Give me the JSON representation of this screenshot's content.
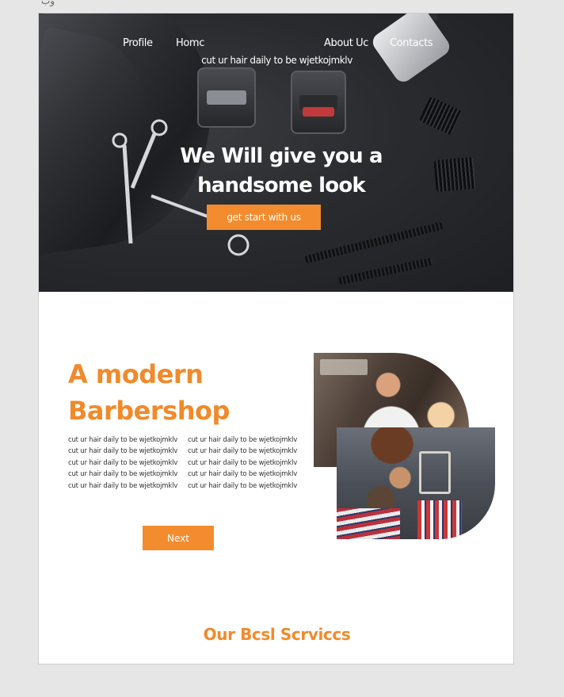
{
  "page": {
    "top_label": "وب"
  },
  "nav": {
    "items": [
      {
        "label": "Profile"
      },
      {
        "label": "Homc"
      },
      {
        "label": "About Uc"
      },
      {
        "label": "Contacts"
      }
    ]
  },
  "hero": {
    "tagline": "cut ur hair daily to be wjetkojmklv",
    "heading_line1": "We Will give you a",
    "heading_line2": "handsome look",
    "cta_label": "get start with us"
  },
  "about": {
    "title_line1": "A modern",
    "title_line2": "Barbershop",
    "text_col1": [
      "cut ur hair daily to be wjetkojmklv",
      "cut ur hair daily to be wjetkojmklv",
      "cut ur hair daily to be wjetkojmklv",
      "cut ur hair daily to be wjetkojmklv",
      "cut ur hair daily to be wjetkojmklv"
    ],
    "text_col2": [
      "cut ur hair daily to be wjetkojmklv",
      "cut ur hair daily to be wjetkojmklv",
      "cut ur hair daily to be wjetkojmklv",
      "cut ur hair daily to be wjetkojmklv",
      "cut ur hair daily to be wjetkojmklv"
    ],
    "next_label": "Next"
  },
  "services": {
    "title": "Our Bcsl Scrviccs"
  },
  "colors": {
    "accent": "#f28c2e",
    "accent_text": "#f08a2b",
    "hero_bg": "#2a2b2f"
  }
}
